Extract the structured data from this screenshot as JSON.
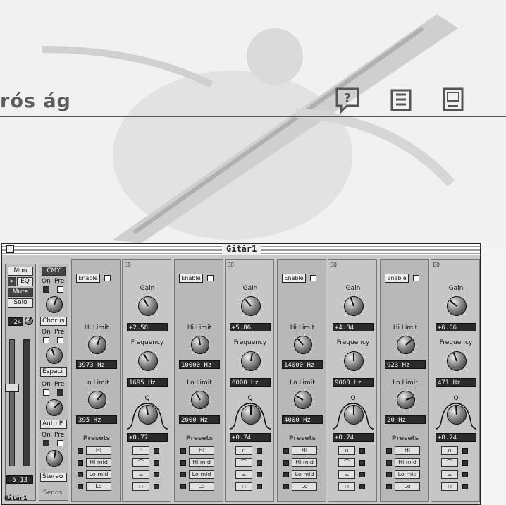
{
  "page": {
    "title": "rós ág",
    "icons": [
      "help-icon",
      "book-icon",
      "computer-icon"
    ]
  },
  "window": {
    "title": "Gitár1",
    "strip": {
      "mon": "Mon",
      "eq": "EQ",
      "mute": "Mute",
      "solo": "Solo",
      "volume": "-24",
      "level": "-5.13",
      "name": "Gitár1"
    },
    "sends": {
      "header": "CMY",
      "on": "On",
      "pre": "Pre",
      "slots": [
        "Chorus",
        "Espaci",
        "Auto P"
      ],
      "output": "Stereo",
      "footer": "Sends"
    },
    "eq_labels": {
      "tag": "EQ",
      "enable": "Enable",
      "gain": "Gain",
      "hi_limit": "Hi Limit",
      "lo_limit": "Lo Limit",
      "frequency": "Frequency",
      "q": "Q",
      "presets": "Presets",
      "preset_items": [
        "Hi",
        "Hi mid",
        "Lo mid",
        "Lo"
      ]
    },
    "bands": [
      {
        "hi": "3973 Hz",
        "lo": "395 Hz",
        "gain": "+2.58",
        "freq": "1695 Hz",
        "q": "+0.77"
      },
      {
        "hi": "10000 Hz",
        "lo": "2000 Hz",
        "gain": "+5.86",
        "freq": "6000 Hz",
        "q": "+0.74"
      },
      {
        "hi": "14000 Hz",
        "lo": "4000 Hz",
        "gain": "+4.84",
        "freq": "9000 Hz",
        "q": "+0.74"
      },
      {
        "hi": "923 Hz",
        "lo": "20 Hz",
        "gain": "+6.06",
        "freq": "471 Hz",
        "q": "+0.74"
      }
    ]
  }
}
